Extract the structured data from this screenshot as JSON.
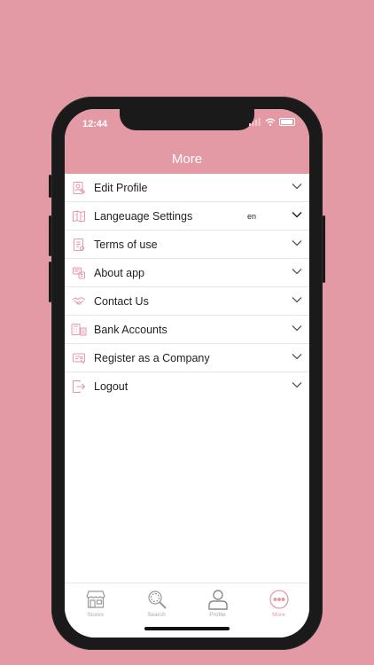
{
  "status_bar": {
    "time": "12:44"
  },
  "header": {
    "title": "More"
  },
  "menu": {
    "items": [
      {
        "label": "Edit Profile",
        "icon": "edit-profile-icon"
      },
      {
        "label": "Langeuage Settings",
        "value": "en",
        "icon": "language-icon"
      },
      {
        "label": "Terms of use",
        "icon": "terms-document-icon"
      },
      {
        "label": "About app",
        "icon": "about-app-icon"
      },
      {
        "label": "Contact Us",
        "icon": "contact-handshake-icon"
      },
      {
        "label": "Bank Accounts",
        "icon": "bank-calculator-icon"
      },
      {
        "label": "Register as a Company",
        "icon": "register-company-icon"
      },
      {
        "label": "Logout",
        "icon": "logout-icon"
      }
    ]
  },
  "tabbar": {
    "tabs": [
      {
        "label": "Stores",
        "icon": "store-icon",
        "active": false
      },
      {
        "label": "Search",
        "icon": "search-icon",
        "active": false
      },
      {
        "label": "Profile",
        "icon": "profile-icon",
        "active": false
      },
      {
        "label": "More",
        "icon": "more-icon",
        "active": true
      }
    ]
  },
  "colors": {
    "accent": "#E39AA5",
    "background": "#E39AA5",
    "inactive": "#aaaaaa"
  }
}
